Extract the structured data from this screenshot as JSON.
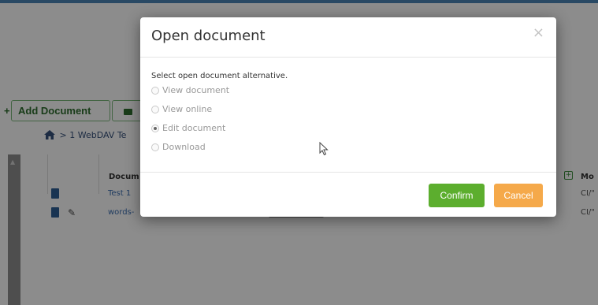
{
  "toolbar": {
    "add_document_label": "Add Document",
    "add_document_prefix": "+"
  },
  "breadcrumb": {
    "separator": ">",
    "path_text": "1 WebDAV Te"
  },
  "table": {
    "headers": {
      "document": "Docum",
      "modified": "Mo"
    },
    "rows": [
      {
        "name": "Test 1",
        "date": "СІ/\""
      },
      {
        "name": "words-",
        "date": "СІ/\""
      }
    ]
  },
  "modal": {
    "title": "Open document",
    "close_symbol": "×",
    "instruction": "Select open document alternative.",
    "options": [
      {
        "label": "View document",
        "checked": false
      },
      {
        "label": "View online",
        "checked": false
      },
      {
        "label": "Edit document",
        "checked": true
      },
      {
        "label": "Download",
        "checked": false
      }
    ],
    "confirm_label": "Confirm",
    "cancel_label": "Cancel"
  },
  "colors": {
    "confirm": "#5cae2e",
    "cancel": "#f5a94a",
    "header_bar": "#4c86b7",
    "toolbar_green": "#2e6d2e",
    "link_blue": "#3b6db0"
  },
  "icons": {
    "folder": "folder-icon",
    "home": "home-icon",
    "document": "document-icon",
    "edit": "pencil-icon",
    "add_column": "plus-box-icon",
    "cursor": "mouse-cursor-icon"
  }
}
